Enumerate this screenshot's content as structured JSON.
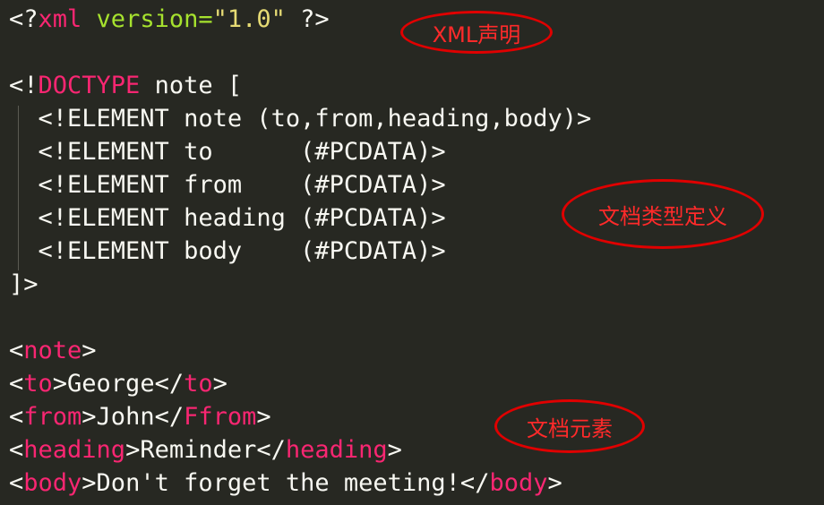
{
  "code": {
    "l1": {
      "a": "<?",
      "b": "xml",
      "c": " version=",
      "d": "\"1.0\"",
      "e": " ?>"
    },
    "l3": {
      "a": "<!",
      "b": "DOCTYPE",
      "c": " note ["
    },
    "l4": "  <!ELEMENT note (to,from,heading,body)>",
    "l5": "  <!ELEMENT to      (#PCDATA)>",
    "l6": "  <!ELEMENT from    (#PCDATA)>",
    "l7": "  <!ELEMENT heading (#PCDATA)>",
    "l8": "  <!ELEMENT body    (#PCDATA)>",
    "l9": "]>",
    "l11": {
      "a": "<",
      "b": "note",
      "c": ">"
    },
    "l12": {
      "a": "<",
      "b": "to",
      "c": ">George</",
      "d": "to",
      "e": ">"
    },
    "l13": {
      "a": "<",
      "b": "from",
      "c": ">John</",
      "d": "Ffrom",
      "e": ">"
    },
    "l14": {
      "a": "<",
      "b": "heading",
      "c": ">Reminder</",
      "d": "heading",
      "e": ">"
    },
    "l15": {
      "a": "<",
      "b": "body",
      "c": ">Don't forget the meeting!</",
      "d": "body",
      "e": ">"
    }
  },
  "annotations": {
    "xml_declaration": "XML声明",
    "doctype_definition": "文档类型定义",
    "document_elements": "文档元素"
  },
  "colors": {
    "background": "#272822",
    "tag": "#f92672",
    "keyword": "#a6e22e",
    "string": "#e6db74",
    "text": "#f8f8f2",
    "annotation": "#e00000"
  }
}
